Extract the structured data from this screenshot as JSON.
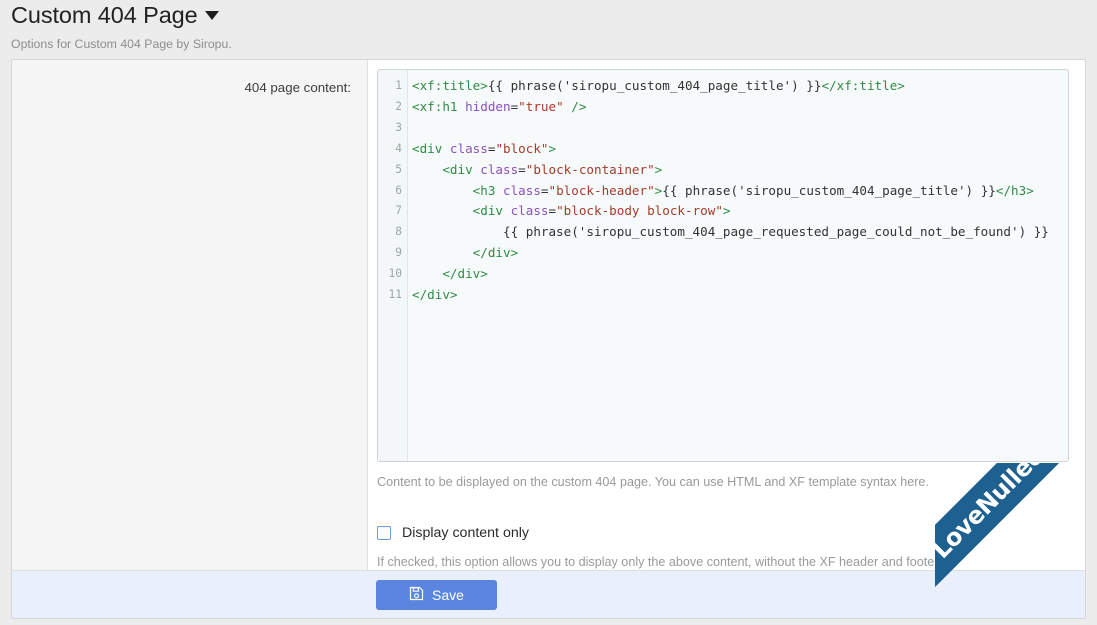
{
  "header": {
    "title": "Custom 404 Page",
    "caret_icon": "chevron-down-icon",
    "subtitle": "Options for Custom 404 Page by Siropu."
  },
  "form": {
    "field_label": "404 page content:",
    "editor": {
      "line_numbers": [
        "1",
        "2",
        "3",
        "4",
        "5",
        "6",
        "7",
        "8",
        "9",
        "10",
        "11"
      ],
      "lines": [
        [
          {
            "t": "tag",
            "s": "<xf:title>"
          },
          {
            "t": "plain",
            "s": "{{ phrase('siropu_custom_404_page_title') }}"
          },
          {
            "t": "tag",
            "s": "</xf:title>"
          }
        ],
        [
          {
            "t": "tag",
            "s": "<xf:h1 "
          },
          {
            "t": "attr",
            "s": "hidden"
          },
          {
            "t": "plain",
            "s": "="
          },
          {
            "t": "str",
            "s": "\"true\""
          },
          {
            "t": "tag",
            "s": " />"
          }
        ],
        [],
        [
          {
            "t": "tag",
            "s": "<div "
          },
          {
            "t": "attr",
            "s": "class"
          },
          {
            "t": "plain",
            "s": "="
          },
          {
            "t": "str",
            "s": "\"block\""
          },
          {
            "t": "tag",
            "s": ">"
          }
        ],
        [
          {
            "t": "tag",
            "s": "    <div "
          },
          {
            "t": "attr",
            "s": "class"
          },
          {
            "t": "plain",
            "s": "="
          },
          {
            "t": "str",
            "s": "\"block-container\""
          },
          {
            "t": "tag",
            "s": ">"
          }
        ],
        [
          {
            "t": "tag",
            "s": "        <h3 "
          },
          {
            "t": "attr",
            "s": "class"
          },
          {
            "t": "plain",
            "s": "="
          },
          {
            "t": "str",
            "s": "\"block-header\""
          },
          {
            "t": "tag",
            "s": ">"
          },
          {
            "t": "plain",
            "s": "{{ phrase('siropu_custom_404_page_title') }}"
          },
          {
            "t": "tag",
            "s": "</h3>"
          }
        ],
        [
          {
            "t": "tag",
            "s": "        <div "
          },
          {
            "t": "attr",
            "s": "class"
          },
          {
            "t": "plain",
            "s": "="
          },
          {
            "t": "str",
            "s": "\"block-body block-row\""
          },
          {
            "t": "tag",
            "s": ">"
          }
        ],
        [
          {
            "t": "plain",
            "s": "            {{ phrase('siropu_custom_404_page_requested_page_could_not_be_found') }}"
          }
        ],
        [
          {
            "t": "tag",
            "s": "        </div>"
          }
        ],
        [
          {
            "t": "tag",
            "s": "    </div>"
          }
        ],
        [
          {
            "t": "tag",
            "s": "</div>"
          }
        ]
      ]
    },
    "editor_explain": "Content to be displayed on the custom 404 page. You can use HTML and XF template syntax here.",
    "checkbox": {
      "label": "Display content only",
      "checked": false,
      "hint": "If checked, this option allows you to display only the above content, without the XF header and footer."
    }
  },
  "footer": {
    "save_label": "Save",
    "save_icon": "save-floppy-icon"
  },
  "watermark": {
    "text": "LoveNulled.com",
    "heart_icon": "heart-icon",
    "band_color": "#1e6090",
    "heart_color": "#e01b24"
  },
  "colors": {
    "page_background": "#ececec",
    "card_background": "#ffffff",
    "label_column_background": "#f5f5f5",
    "editor_background": "#f7fafb",
    "submit_bar_background": "#eaf0fb",
    "accent_button": "#5b86e0",
    "syntax_tag": "#2e8b45",
    "syntax_attr": "#8a52ba",
    "syntax_string": "#a63b2a",
    "syntax_plain": "#333333"
  }
}
